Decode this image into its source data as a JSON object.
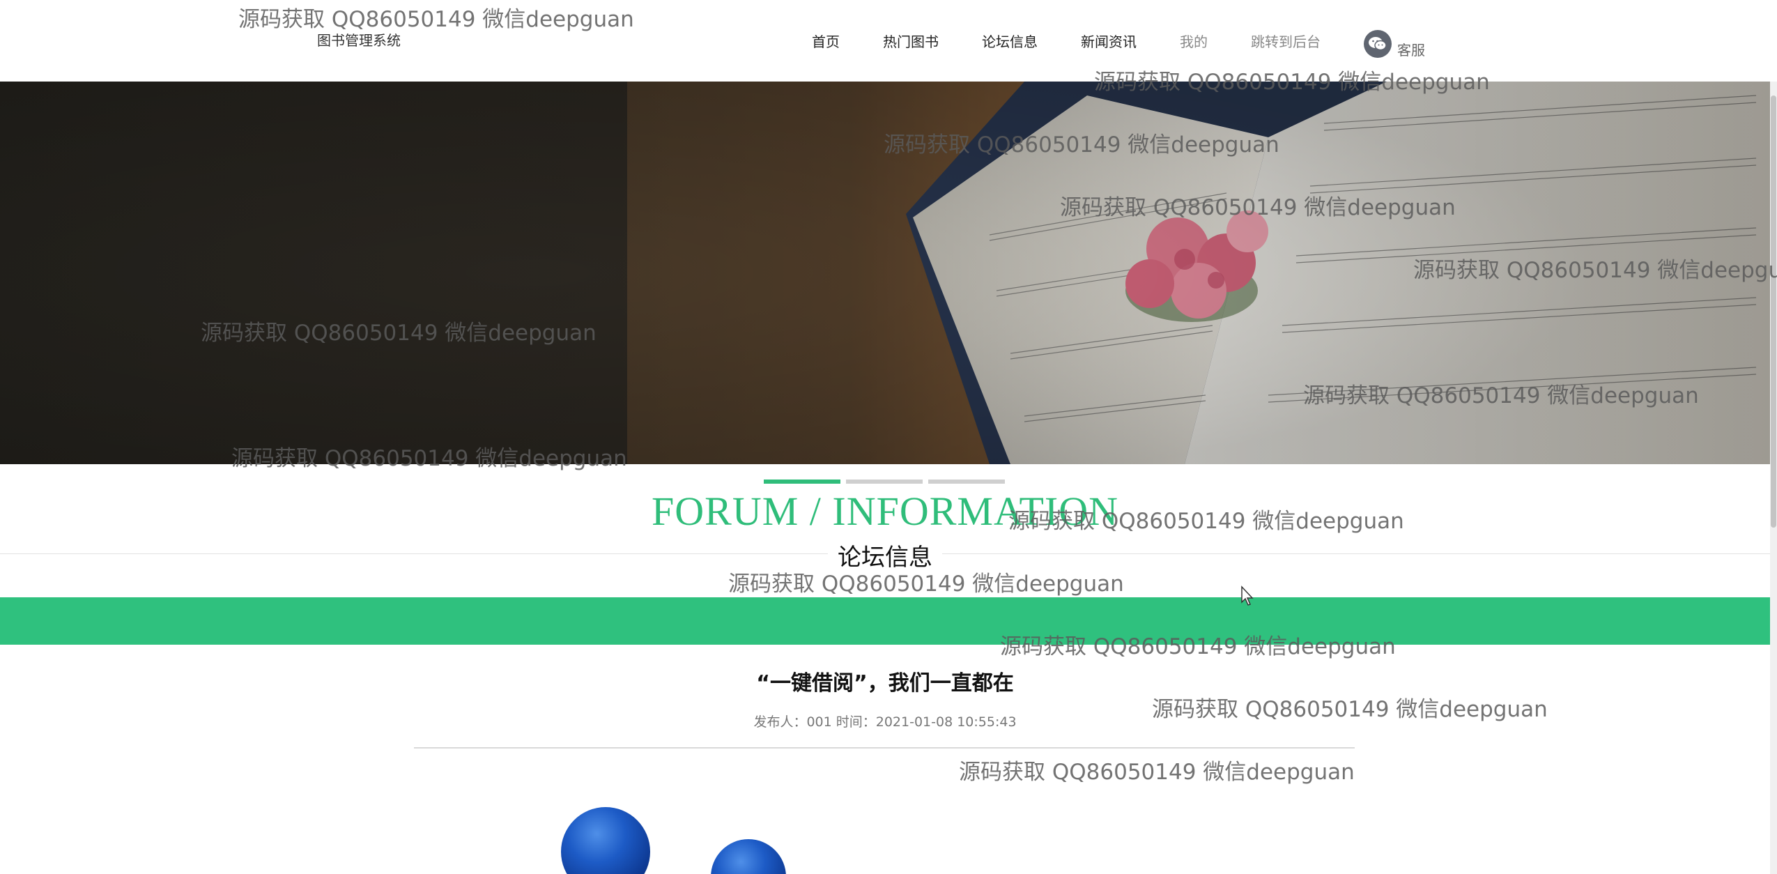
{
  "header": {
    "brand": "图书管理系统",
    "nav": [
      {
        "label": "首页"
      },
      {
        "label": "热门图书"
      },
      {
        "label": "论坛信息"
      },
      {
        "label": "新闻资讯"
      },
      {
        "label": "我的"
      },
      {
        "label": "跳转到后台"
      }
    ],
    "service_label": "客服"
  },
  "banner": {
    "slides_count": 3,
    "active_slide": 1
  },
  "section": {
    "title_en": "FORUM / INFORMATION",
    "title_zh": "论坛信息"
  },
  "article": {
    "title": "“一键借阅”，我们一直都在",
    "meta": "发布人：001 时间：2021-01-08 10:55:43"
  },
  "watermark": {
    "text": "源码获取 QQ86050149 微信deepguan"
  },
  "colors": {
    "accent": "#2fbd7a",
    "bar": "#2fc17e"
  }
}
